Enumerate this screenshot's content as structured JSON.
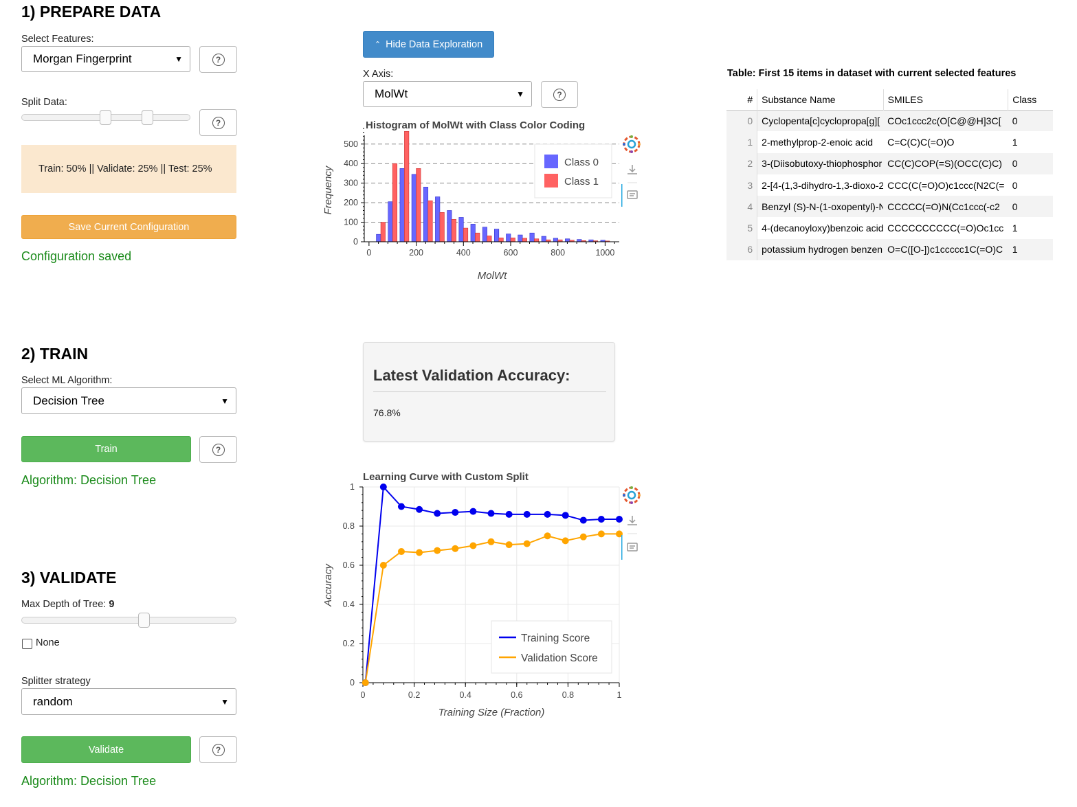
{
  "prepare": {
    "heading": "1) PREPARE DATA",
    "features_label": "Select Features:",
    "features_value": "Morgan Fingerprint",
    "split_label": "Split Data:",
    "split_handles": [
      0.5,
      0.75
    ],
    "split_info": "Train: 50% || Validate: 25% || Test: 25%",
    "save_button": "Save Current Configuration",
    "status": "Configuration saved"
  },
  "exploration": {
    "toggle_button": "Hide Data Exploration",
    "xaxis_label": "X Axis:",
    "xaxis_value": "MolWt"
  },
  "train": {
    "heading": "2) TRAIN",
    "algo_label": "Select ML Algorithm:",
    "algo_value": "Decision Tree",
    "train_button": "Train",
    "status": "Algorithm: Decision Tree"
  },
  "validate": {
    "heading": "3) VALIDATE",
    "depth_label": "Max Depth of Tree: ",
    "depth_value": "9",
    "depth_slider": 9,
    "none_label": "None",
    "splitter_label": "Splitter strategy",
    "splitter_value": "random",
    "validate_button": "Validate",
    "status": "Algorithm: Decision Tree"
  },
  "accuracy_panel": {
    "title": "Latest Validation Accuracy:",
    "value": "76.8%"
  },
  "table": {
    "title": "Table: First 15 items in dataset with current selected features",
    "headers": [
      "#",
      "Substance Name",
      "SMILES",
      "Class"
    ],
    "rows": [
      {
        "idx": "0",
        "name": "Cyclopenta[c]cyclopropa[g][",
        "smiles": "COc1ccc2c(O[C@@H]3C[",
        "cls": "0"
      },
      {
        "idx": "1",
        "name": "2-methylprop-2-enoic acid",
        "smiles": "C=C(C)C(=O)O",
        "cls": "1"
      },
      {
        "idx": "2",
        "name": "3-(Diisobutoxy-thiophosphor",
        "smiles": "CC(C)COP(=S)(OCC(C)C)",
        "cls": "0"
      },
      {
        "idx": "3",
        "name": "2-[4-(1,3-dihydro-1,3-dioxo-2",
        "smiles": "CCC(C(=O)O)c1ccc(N2C(=",
        "cls": "0"
      },
      {
        "idx": "4",
        "name": "Benzyl (S)-N-(1-oxopentyl)-N",
        "smiles": "CCCCC(=O)N(Cc1ccc(-c2",
        "cls": "0"
      },
      {
        "idx": "5",
        "name": "4-(decanoyloxy)benzoic acid",
        "smiles": "CCCCCCCCCC(=O)Oc1cc",
        "cls": "1"
      },
      {
        "idx": "6",
        "name": "potassium hydrogen benzen",
        "smiles": "O=C([O-])c1ccccc1C(=O)C",
        "cls": "1"
      }
    ]
  },
  "colors": {
    "class0": "#6767ff",
    "class1": "#ff6262",
    "training": "#0000ee",
    "validation": "#ffa500",
    "green_button": "#5cb85c",
    "save_button": "#f0ad4e",
    "status_green": "#1a8a1a",
    "blue_button": "#428bca"
  },
  "chart_data": [
    {
      "type": "bar",
      "title": "Histogram of MolWt with Class Color Coding",
      "xlabel": "MolWt",
      "ylabel": "Frequency",
      "xlim": [
        -20,
        1060
      ],
      "ylim": [
        0,
        580
      ],
      "xticks": [
        0,
        200,
        400,
        600,
        800,
        1000
      ],
      "yticks": [
        0,
        100,
        200,
        300,
        400,
        500
      ],
      "bin_centers": [
        50,
        100,
        150,
        200,
        250,
        300,
        350,
        400,
        450,
        500,
        550,
        600,
        650,
        700,
        750,
        800,
        850,
        900,
        950,
        1000
      ],
      "series": [
        {
          "name": "Class 0",
          "values": [
            38,
            205,
            375,
            345,
            280,
            230,
            160,
            125,
            90,
            75,
            65,
            40,
            35,
            45,
            28,
            18,
            15,
            12,
            10,
            8
          ]
        },
        {
          "name": "Class 1",
          "values": [
            100,
            400,
            565,
            375,
            210,
            150,
            115,
            70,
            45,
            30,
            20,
            20,
            18,
            15,
            10,
            10,
            8,
            6,
            5,
            4
          ]
        }
      ],
      "grid": "y-dashed",
      "legend": "top-right"
    },
    {
      "type": "line",
      "title": "Learning Curve with Custom Split",
      "xlabel": "Training Size (Fraction)",
      "ylabel": "Accuracy",
      "xlim": [
        0,
        1
      ],
      "ylim": [
        0,
        1
      ],
      "xticks": [
        "0",
        "0.2",
        "0.4",
        "0.6",
        "0.8",
        "1"
      ],
      "yticks": [
        "0",
        "0.2",
        "0.4",
        "0.6",
        "0.8",
        "1"
      ],
      "x": [
        0.01,
        0.08,
        0.15,
        0.22,
        0.29,
        0.36,
        0.43,
        0.5,
        0.57,
        0.64,
        0.72,
        0.79,
        0.86,
        0.93,
        1.0
      ],
      "series": [
        {
          "name": "Training Score",
          "values": [
            0.0,
            1.0,
            0.9,
            0.885,
            0.865,
            0.87,
            0.875,
            0.865,
            0.86,
            0.86,
            0.86,
            0.855,
            0.83,
            0.835,
            0.835
          ]
        },
        {
          "name": "Validation Score",
          "values": [
            0.0,
            0.6,
            0.67,
            0.665,
            0.675,
            0.685,
            0.7,
            0.72,
            0.705,
            0.71,
            0.75,
            0.725,
            0.745,
            0.76,
            0.76
          ]
        }
      ],
      "grid": "both",
      "legend": "bottom-right"
    }
  ]
}
